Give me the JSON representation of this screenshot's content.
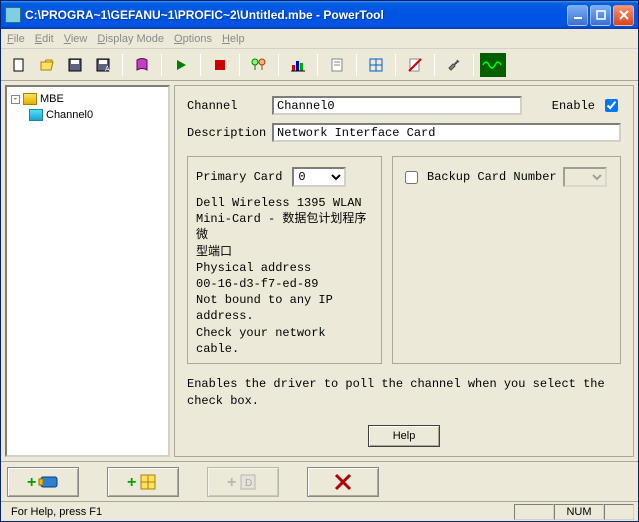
{
  "window": {
    "title": "C:\\PROGRA~1\\GEFANU~1\\PROFIC~2\\Untitled.mbe - PowerTool"
  },
  "menu": {
    "file": "File",
    "edit": "Edit",
    "view": "View",
    "display_mode": "Display Mode",
    "options": "Options",
    "help": "Help"
  },
  "tree": {
    "root": "MBE",
    "child0": "Channel0"
  },
  "form": {
    "channel_label": "Channel",
    "channel_value": "Channel0",
    "enable_label": "Enable",
    "enable_checked": true,
    "description_label": "Description",
    "description_value": "Network Interface Card"
  },
  "primary": {
    "label": "Primary Card",
    "selected": "0",
    "info_l1": "Dell Wireless 1395 WLAN",
    "info_l2": "Mini-Card - 数据包计划程序微",
    "info_l3": "型端口",
    "info_l4": "Physical address",
    "info_l5": "00-16-d3-f7-ed-89",
    "info_l6": "Not bound to any IP address.",
    "info_l7": "Check your network cable."
  },
  "backup": {
    "label": "Backup Card Number",
    "checked": false,
    "selected": ""
  },
  "hint": "Enables the driver to poll the channel when you select the check box.",
  "buttons": {
    "help": "Help"
  },
  "status": {
    "left": "For Help, press F1",
    "num": "NUM"
  }
}
